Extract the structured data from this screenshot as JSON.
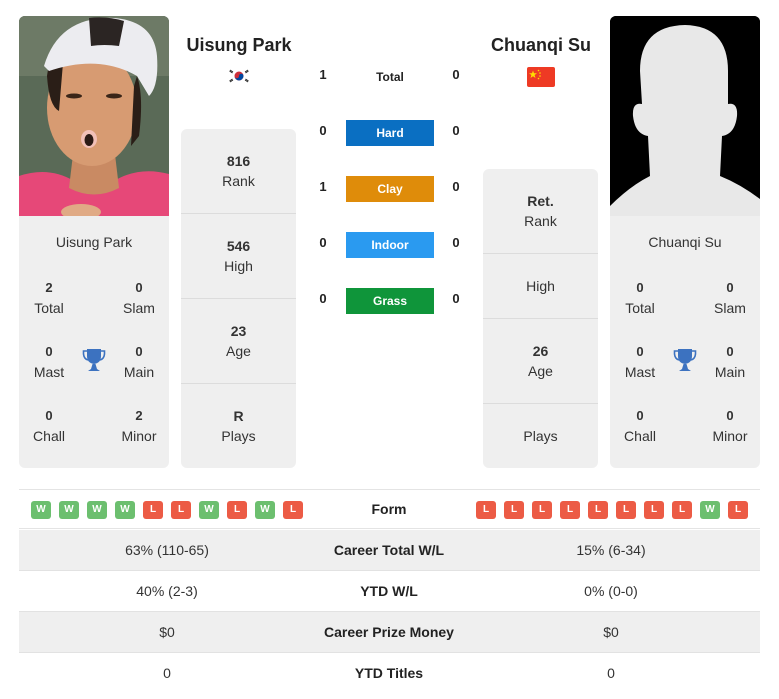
{
  "players": {
    "left": {
      "name": "Uisung Park",
      "country": "South Korea",
      "flag_icon": "south-korea-flag",
      "card_name": "Uisung Park",
      "titles": {
        "total": "2",
        "total_label": "Total",
        "slam": "0",
        "slam_label": "Slam",
        "mast": "0",
        "mast_label": "Mast",
        "main": "0",
        "main_label": "Main",
        "chall": "0",
        "chall_label": "Chall",
        "minor": "2",
        "minor_label": "Minor"
      },
      "rank": {
        "value": "816",
        "label": "Rank"
      },
      "high": {
        "value": "546",
        "label": "High"
      },
      "age": {
        "value": "23",
        "label": "Age"
      },
      "plays": {
        "value": "R",
        "label": "Plays"
      }
    },
    "right": {
      "name": "Chuanqi Su",
      "country": "China",
      "flag_icon": "china-flag",
      "card_name": "Chuanqi Su",
      "titles": {
        "total": "0",
        "total_label": "Total",
        "slam": "0",
        "slam_label": "Slam",
        "mast": "0",
        "mast_label": "Mast",
        "main": "0",
        "main_label": "Main",
        "chall": "0",
        "chall_label": "Chall",
        "minor": "0",
        "minor_label": "Minor"
      },
      "rank": {
        "value": "Ret.",
        "label": "Rank"
      },
      "high": {
        "value": "",
        "label": "High"
      },
      "age": {
        "value": "26",
        "label": "Age"
      },
      "plays": {
        "value": "",
        "label": "Plays"
      }
    }
  },
  "h2h": {
    "total": {
      "label": "Total",
      "left": "1",
      "right": "0"
    },
    "surfaces": [
      {
        "label": "Hard",
        "left": "0",
        "right": "0",
        "color": "#0a6fc2"
      },
      {
        "label": "Clay",
        "left": "1",
        "right": "0",
        "color": "#df8c0a"
      },
      {
        "label": "Indoor",
        "left": "0",
        "right": "0",
        "color": "#2a9af0"
      },
      {
        "label": "Grass",
        "left": "0",
        "right": "0",
        "color": "#0f953a"
      }
    ]
  },
  "form": {
    "label": "Form",
    "left": [
      "W",
      "W",
      "W",
      "W",
      "L",
      "L",
      "W",
      "L",
      "W",
      "L"
    ],
    "right": [
      "L",
      "L",
      "L",
      "L",
      "L",
      "L",
      "L",
      "L",
      "W",
      "L"
    ]
  },
  "stats": [
    {
      "label": "Career Total W/L",
      "left": "63% (110-65)",
      "right": "15% (6-34)"
    },
    {
      "label": "YTD W/L",
      "left": "40% (2-3)",
      "right": "0% (0-0)"
    },
    {
      "label": "Career Prize Money",
      "left": "$0",
      "right": "$0"
    },
    {
      "label": "YTD Titles",
      "left": "0",
      "right": "0"
    }
  ],
  "colors": {
    "win": "#6cbf6f",
    "loss": "#ec5b45",
    "trophy": "#3c72c0"
  }
}
